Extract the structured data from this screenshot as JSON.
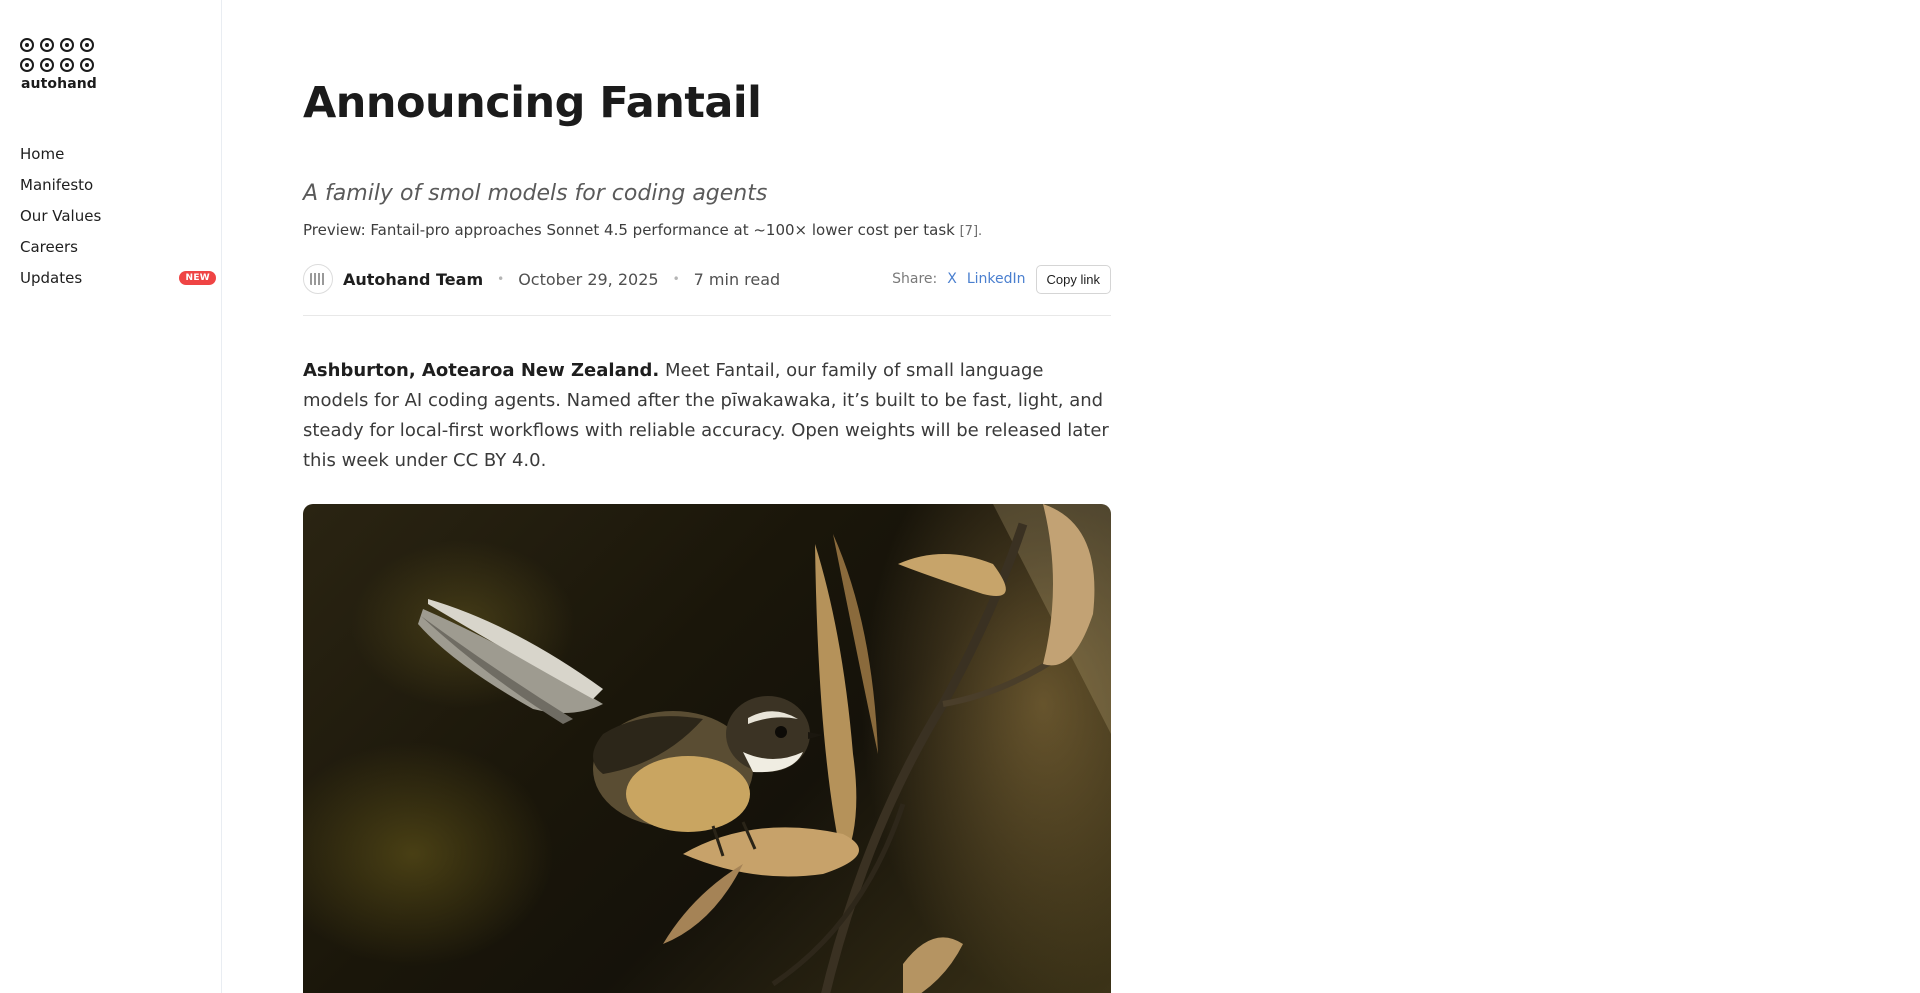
{
  "sidebar": {
    "logo_text": "autohand",
    "items": [
      {
        "label": "Home"
      },
      {
        "label": "Manifesto"
      },
      {
        "label": "Our Values"
      },
      {
        "label": "Careers"
      },
      {
        "label": "Updates",
        "badge": "NEW"
      }
    ]
  },
  "article": {
    "title": "Announcing Fantail",
    "subtitle": "A family of smol models for coding agents",
    "preview_text": "Preview: Fantail-pro approaches Sonnet 4.5 performance at ~100× lower cost per task",
    "preview_ref": "[7].",
    "author": "Autohand Team",
    "date": "October 29, 2025",
    "read_time": "7 min read",
    "share_label": "Share:",
    "share_x": "X",
    "share_linkedin": "LinkedIn",
    "copy_link": "Copy link",
    "lead_bold": "Ashburton, Aotearoa New Zealand.",
    "lead_text": "Meet Fantail, our family of small language models for AI coding agents. Named after the pīwakawaka, it’s built to be fast, light, and steady for local-first workflows with reliable accuracy. Open weights will be released later this week under CC BY 4.0."
  },
  "hero_image": {
    "subject": "fantail-bird-on-flax-seed-pods"
  },
  "colors": {
    "accent_link": "#4a7fcf",
    "badge_red": "#ef4444",
    "text_primary": "#1b1b1b",
    "sidebar_border": "#e9edf2"
  }
}
